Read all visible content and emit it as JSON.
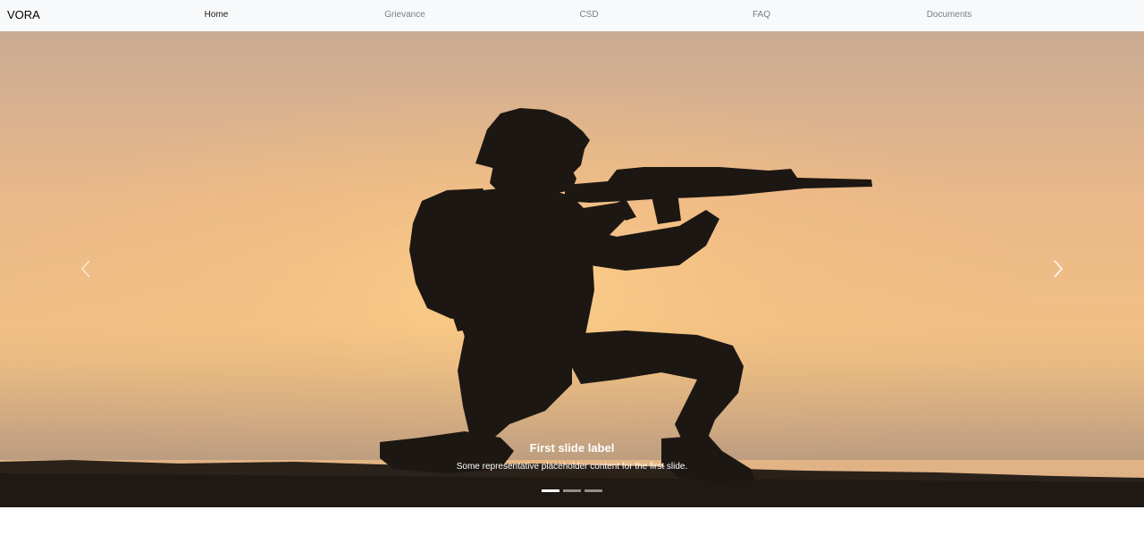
{
  "navbar": {
    "brand": "VORA",
    "links": [
      {
        "label": "Home",
        "active": true
      },
      {
        "label": "Grievance",
        "active": false
      },
      {
        "label": "CSD",
        "active": false
      },
      {
        "label": "FAQ",
        "active": false
      },
      {
        "label": "Documents",
        "active": false
      }
    ]
  },
  "carousel": {
    "slide_count": 3,
    "active_slide": 1,
    "caption": {
      "title": "First slide label",
      "text": "Some representative placeholder content for the first slide."
    },
    "icons": {
      "prev": "chevron-left-icon",
      "next": "chevron-right-icon"
    }
  },
  "colors": {
    "navbar_bg": "#f8f9fa",
    "sky_top": "#c9ab93",
    "sky_glow": "#f8c57f",
    "silhouette": "#1c1712"
  }
}
